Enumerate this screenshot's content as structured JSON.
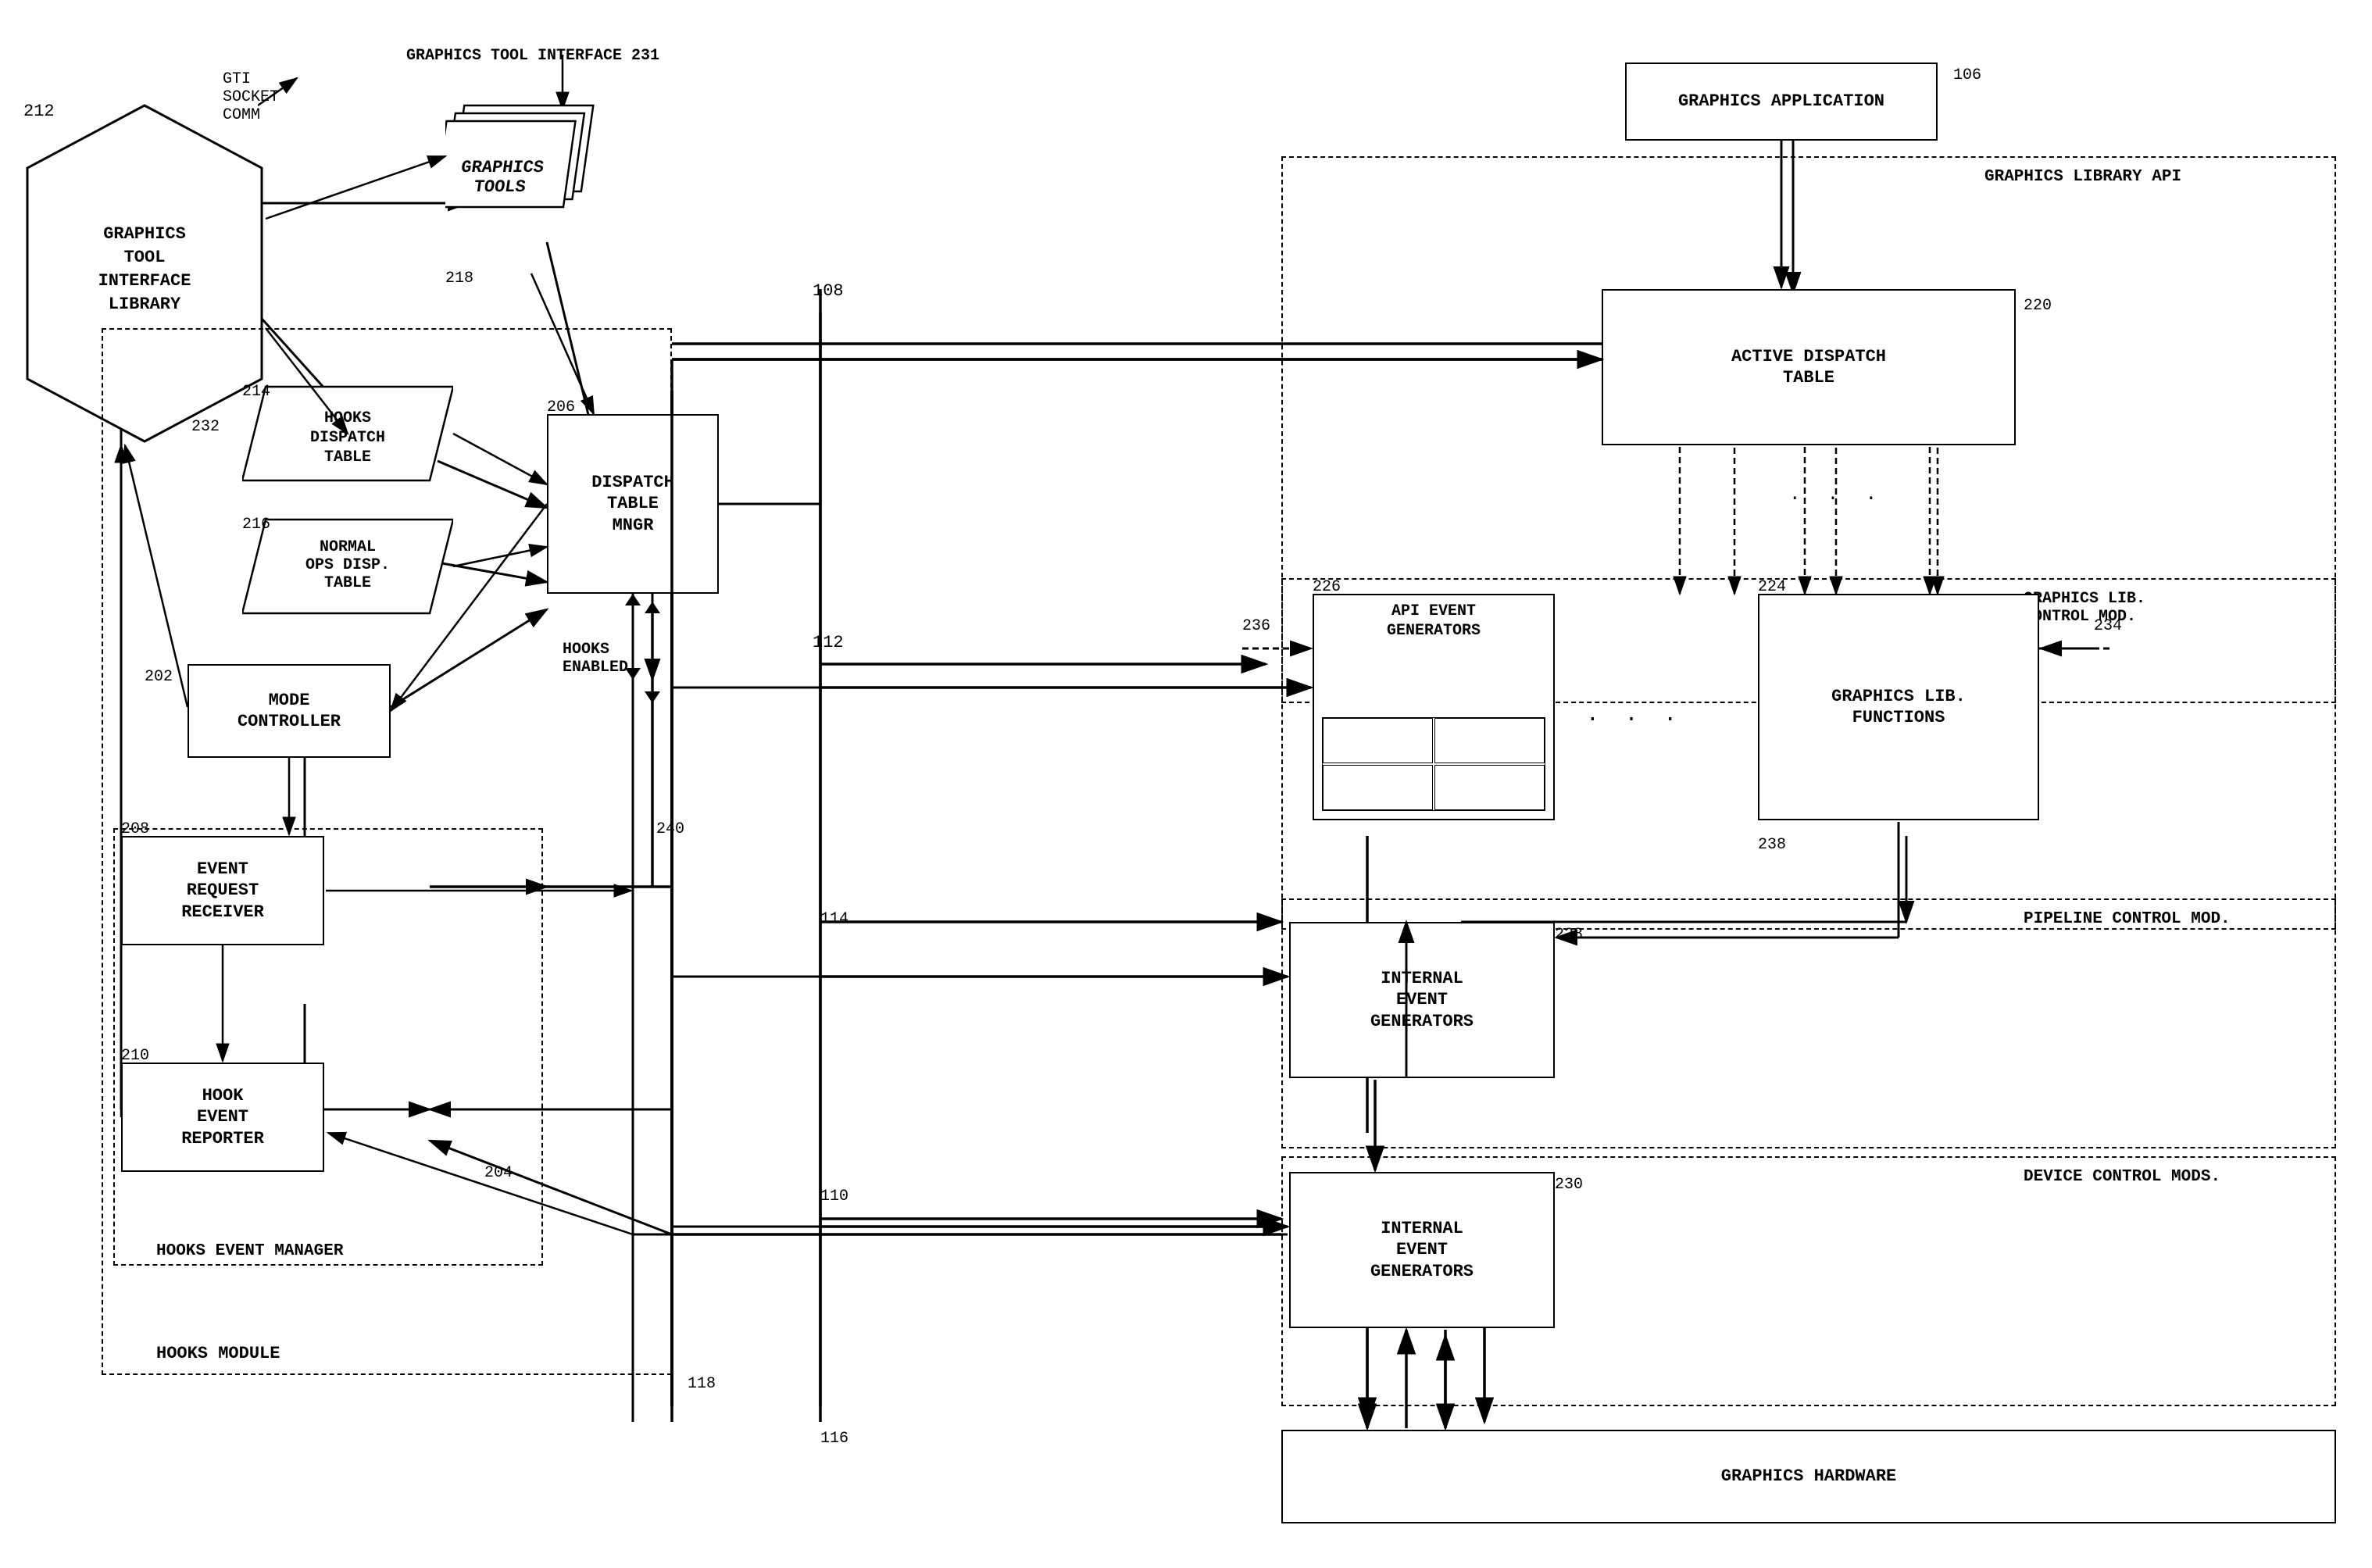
{
  "nodes": {
    "gti_lib": {
      "label": "GRAPHICS\nTOOL\nINTERFACE\nLIBRARY",
      "id": "212"
    },
    "gti_socket": {
      "label": "GTI\nSOCKET\nCOMM"
    },
    "gti_interface": {
      "label": "GRAPHICS TOOL INTERFACE 231"
    },
    "graphics_tools": {
      "label": "GRAPHICS\nTOOLS",
      "id": "218"
    },
    "hooks_dispatch": {
      "label": "HOOKS\nDISPATCH\nTABLE",
      "id": "214"
    },
    "normal_ops": {
      "label": "NORMAL\nOPS DISP.\nTABLE",
      "id": "216"
    },
    "dispatch_mgr": {
      "label": "DISPATCH\nTABLE\nMNGR",
      "id": "206"
    },
    "mode_controller": {
      "label": "MODE\nCONTROLLER",
      "id": "202"
    },
    "event_request": {
      "label": "EVENT\nREQUEST\nRECEIVER",
      "id": "208"
    },
    "hook_event": {
      "label": "HOOK\nEVENT\nREPORTER",
      "id": "210"
    },
    "hooks_enabled": {
      "label": "HOOKS\nENABLED"
    },
    "graphics_app": {
      "label": "GRAPHICS APPLICATION",
      "id": "106"
    },
    "active_dispatch": {
      "label": "ACTIVE DISPATCH\nTABLE",
      "id": "220"
    },
    "api_event_gen": {
      "label": "API EVENT\nGENERATORS",
      "id": "226"
    },
    "graphics_lib_fn": {
      "label": "GRAPHICS LIB.\nFUNCTIONS",
      "id": "224"
    },
    "internal_gen_114": {
      "label": "INTERNAL\nEVENT\nGENERATORS",
      "id": "228"
    },
    "internal_gen_110": {
      "label": "INTERNAL\nEVENT\nGENERATORS",
      "id": "230"
    },
    "graphics_hw": {
      "label": "GRAPHICS HARDWARE",
      "id": "116"
    },
    "hooks_module_label": {
      "label": "HOOKS MODULE"
    },
    "hooks_event_mgr_label": {
      "label": "HOOKS EVENT MANAGER"
    },
    "graphics_lib_api_label": {
      "label": "GRAPHICS LIBRARY API"
    },
    "graphics_lib_ctrl_label": {
      "label": "GRAPHICS LIB.\nCONTROL MOD."
    },
    "pipeline_ctrl_label": {
      "label": "PIPELINE CONTROL MOD."
    },
    "device_ctrl_label": {
      "label": "DEVICE CONTROL MODS."
    },
    "refs": {
      "r108": "108",
      "r112": "112",
      "r114": "114",
      "r110": "110",
      "r118": "118",
      "r202": "202",
      "r204": "204",
      "r240": "240",
      "r232": "232",
      "r234": "234",
      "r236": "236",
      "r238": "238"
    }
  }
}
